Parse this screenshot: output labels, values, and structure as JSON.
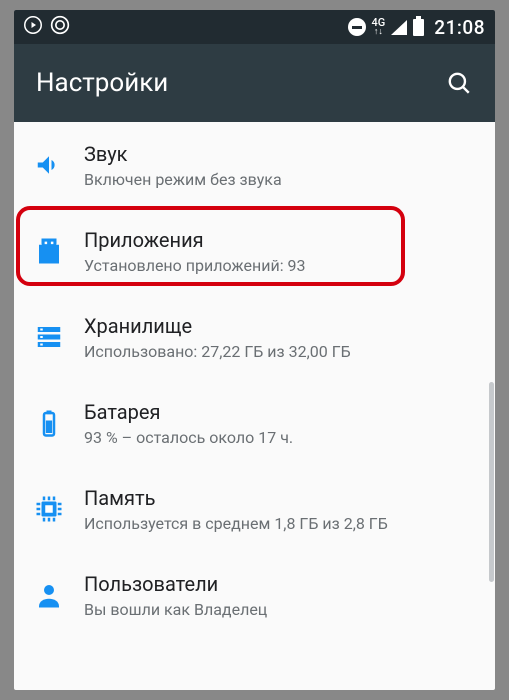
{
  "status": {
    "clock": "21:08",
    "net_top": "4G",
    "net_bot": "↑↓"
  },
  "appbar": {
    "title": "Настройки"
  },
  "items": [
    {
      "title": "Звук",
      "sub": "Включен режим без звука"
    },
    {
      "title": "Приложения",
      "sub": "Установлено приложений: 93"
    },
    {
      "title": "Хранилище",
      "sub": "Использовано: 27,22 ГБ из 32,00 ГБ"
    },
    {
      "title": "Батарея",
      "sub": "93 % – осталось около 17 ч."
    },
    {
      "title": "Память",
      "sub": "Используется в среднем 1,8 ГБ из 2,8 ГБ"
    },
    {
      "title": "Пользователи",
      "sub": "Вы вошли как Владелец"
    }
  ],
  "highlight_index": 1
}
